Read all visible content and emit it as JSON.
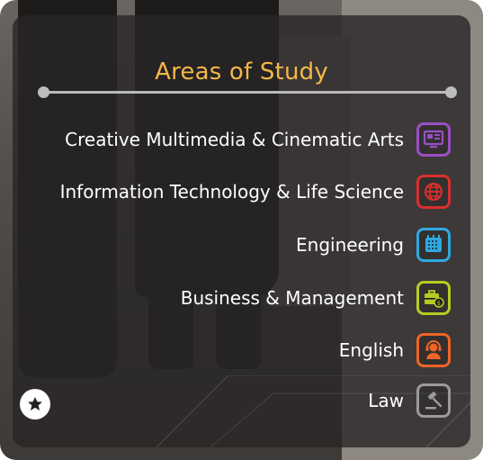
{
  "heading": "Areas of Study",
  "areas": [
    {
      "label": "Creative Multimedia & Cinematic Arts",
      "icon": "media-screen-icon",
      "color": "#9b4fc4"
    },
    {
      "label": "Information Technology & Life Science",
      "icon": "globe-network-icon",
      "color": "#d92f2f"
    },
    {
      "label": "Engineering",
      "icon": "circuit-board-icon",
      "color": "#2fa8e0"
    },
    {
      "label": "Business & Management",
      "icon": "briefcase-dollar-icon",
      "color": "#b5cc22"
    },
    {
      "label": "English",
      "icon": "headset-person-icon",
      "color": "#ef6427"
    },
    {
      "label": "Law",
      "icon": "gavel-icon",
      "color": "#9a9a9a"
    }
  ],
  "colors": {
    "title": "#f3b847",
    "card_bg": "rgba(40,38,38,0.80)",
    "text": "#ffffff"
  },
  "favorite_icon": "star-icon"
}
